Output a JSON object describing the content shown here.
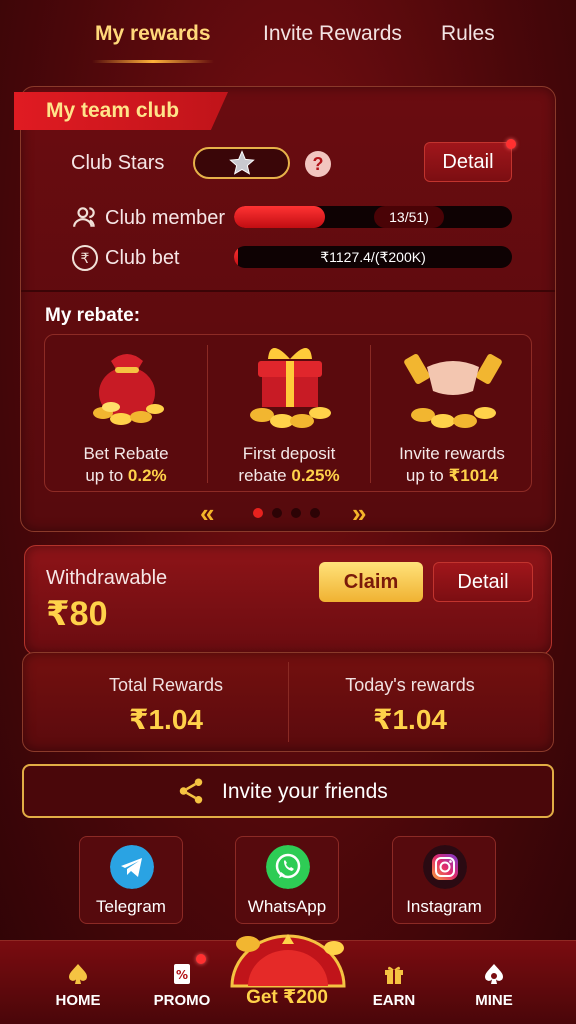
{
  "tabs": [
    {
      "label": "My rewards",
      "active": true
    },
    {
      "label": "Invite Rewards",
      "active": false
    },
    {
      "label": "Rules",
      "active": false
    }
  ],
  "team_club": {
    "title": "My team club",
    "club_stars_label": "Club Stars",
    "help_mark": "?",
    "detail_label": "Detail",
    "member_label": "Club member",
    "member_progress_text": "13/51)",
    "member_progress_fraction": 0.255,
    "bet_label": "Club bet",
    "bet_progress_text": "₹1127.4/(₹200K)",
    "bet_progress_fraction": 0.0056,
    "rupee_glyph": "₹"
  },
  "rebate": {
    "title": "My rebate:",
    "items": [
      {
        "line1": "Bet Rebate",
        "line2_prefix": "up to ",
        "value": "0.2%"
      },
      {
        "line1": "First deposit",
        "line2_prefix": "rebate ",
        "value": "0.25%"
      },
      {
        "line1": "Invite rewards",
        "line2_prefix": "up to ",
        "value": "₹1014"
      }
    ],
    "page_count": 4,
    "active_page": 0
  },
  "withdraw": {
    "label": "Withdrawable",
    "amount": "₹80",
    "claim_label": "Claim",
    "detail_label": "Detail"
  },
  "rewards": {
    "total_label": "Total Rewards",
    "total_value": "₹1.04",
    "today_label": "Today's rewards",
    "today_value": "₹1.04"
  },
  "invite": {
    "label": "Invite your friends"
  },
  "social": [
    {
      "name": "Telegram",
      "icon": "telegram-icon",
      "color": "#2aa3e3"
    },
    {
      "name": "WhatsApp",
      "icon": "whatsapp-icon",
      "color": "#2ecc55"
    },
    {
      "name": "Instagram",
      "icon": "instagram-icon",
      "color": "#d6246e"
    }
  ],
  "nav": {
    "home": "HOME",
    "promo": "PROMO",
    "get": "Get ₹200",
    "earn": "EARN",
    "mine": "MINE"
  },
  "colors": {
    "accent_gold": "#ffd24a",
    "brand_red": "#e01b22",
    "background": "#4a070a"
  }
}
